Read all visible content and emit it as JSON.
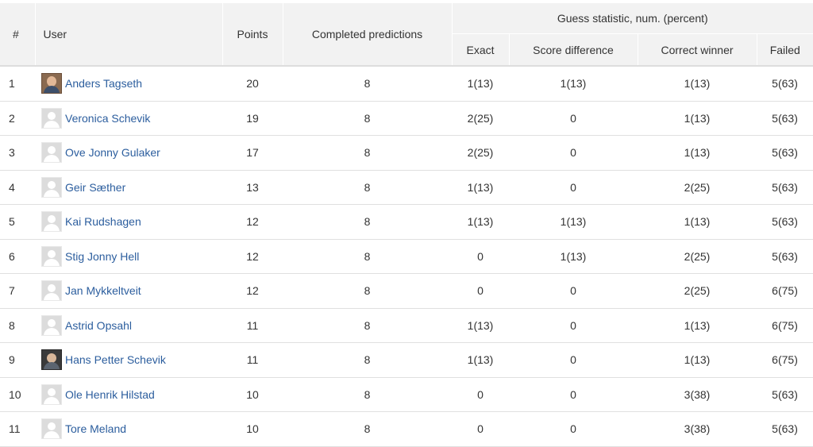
{
  "header": {
    "num": "#",
    "user": "User",
    "points": "Points",
    "completed": "Completed predictions",
    "group": "Guess statistic, num. (percent)",
    "exact": "Exact",
    "score_difference": "Score difference",
    "correct_winner": "Correct winner",
    "failed": "Failed"
  },
  "rows": [
    {
      "rank": "1",
      "name": "Anders Tagseth",
      "avatar": "user-photo-icon",
      "points": "20",
      "completed": "8",
      "exact": "1(13)",
      "score_difference": "1(13)",
      "correct_winner": "1(13)",
      "failed": "5(63)"
    },
    {
      "rank": "2",
      "name": "Veronica Schevik",
      "avatar": "default-avatar-icon",
      "points": "19",
      "completed": "8",
      "exact": "2(25)",
      "score_difference": "0",
      "correct_winner": "1(13)",
      "failed": "5(63)"
    },
    {
      "rank": "3",
      "name": "Ove Jonny Gulaker",
      "avatar": "default-avatar-icon",
      "points": "17",
      "completed": "8",
      "exact": "2(25)",
      "score_difference": "0",
      "correct_winner": "1(13)",
      "failed": "5(63)"
    },
    {
      "rank": "4",
      "name": "Geir Sæther",
      "avatar": "default-avatar-icon",
      "points": "13",
      "completed": "8",
      "exact": "1(13)",
      "score_difference": "0",
      "correct_winner": "2(25)",
      "failed": "5(63)"
    },
    {
      "rank": "5",
      "name": "Kai Rudshagen",
      "avatar": "default-avatar-icon",
      "points": "12",
      "completed": "8",
      "exact": "1(13)",
      "score_difference": "1(13)",
      "correct_winner": "1(13)",
      "failed": "5(63)"
    },
    {
      "rank": "6",
      "name": "Stig Jonny Hell",
      "avatar": "default-avatar-icon",
      "points": "12",
      "completed": "8",
      "exact": "0",
      "score_difference": "1(13)",
      "correct_winner": "2(25)",
      "failed": "5(63)"
    },
    {
      "rank": "7",
      "name": "Jan Mykkeltveit",
      "avatar": "default-avatar-icon",
      "points": "12",
      "completed": "8",
      "exact": "0",
      "score_difference": "0",
      "correct_winner": "2(25)",
      "failed": "6(75)"
    },
    {
      "rank": "8",
      "name": "Astrid Opsahl",
      "avatar": "default-avatar-icon",
      "points": "11",
      "completed": "8",
      "exact": "1(13)",
      "score_difference": "0",
      "correct_winner": "1(13)",
      "failed": "6(75)"
    },
    {
      "rank": "9",
      "name": "Hans Petter Schevik",
      "avatar": "user-photo-icon",
      "points": "11",
      "completed": "8",
      "exact": "1(13)",
      "score_difference": "0",
      "correct_winner": "1(13)",
      "failed": "6(75)"
    },
    {
      "rank": "10",
      "name": "Ole Henrik Hilstad",
      "avatar": "default-avatar-icon",
      "points": "10",
      "completed": "8",
      "exact": "0",
      "score_difference": "0",
      "correct_winner": "3(38)",
      "failed": "5(63)"
    },
    {
      "rank": "11",
      "name": "Tore Meland",
      "avatar": "default-avatar-icon",
      "points": "10",
      "completed": "8",
      "exact": "0",
      "score_difference": "0",
      "correct_winner": "3(38)",
      "failed": "5(63)"
    }
  ],
  "colors": {
    "header_bg": "#f2f2f2",
    "link": "#2c5e9e",
    "text": "#333333",
    "row_border": "#e0e0e0"
  }
}
